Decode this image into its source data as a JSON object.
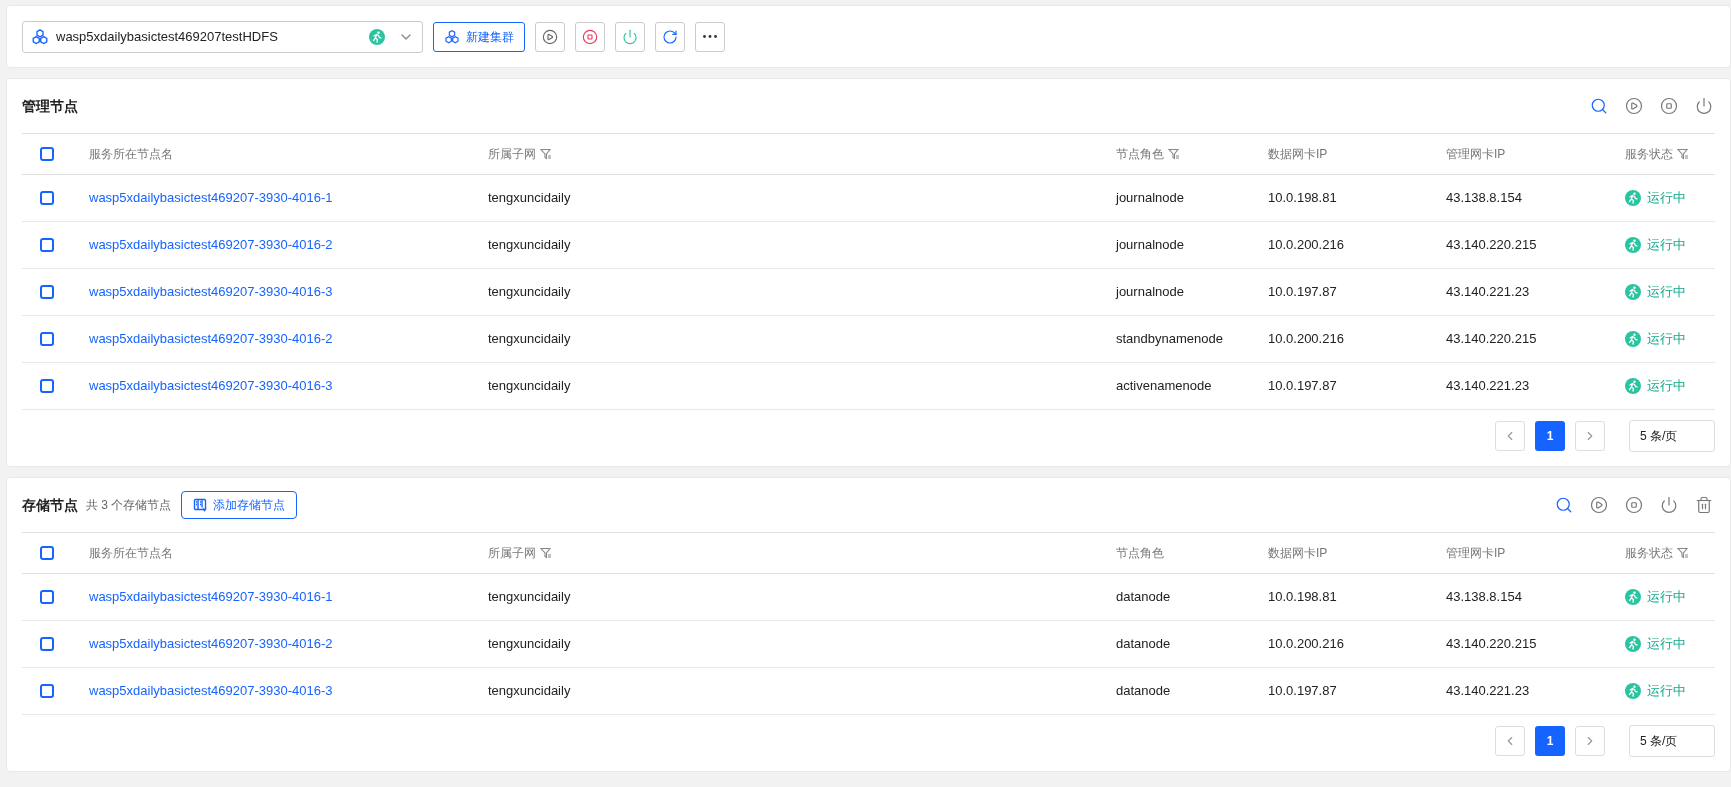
{
  "cluster_select": {
    "value": "wasp5xdailybasictest469207testHDFS",
    "running": true
  },
  "toolbar": {
    "new_cluster": "新建集群",
    "actions": [
      {
        "kind": "start"
      },
      {
        "kind": "stop"
      },
      {
        "kind": "power"
      },
      {
        "kind": "refresh"
      },
      {
        "kind": "more"
      }
    ]
  },
  "sections": [
    {
      "title": "管理节点",
      "actions": [
        {
          "kind": "search"
        },
        {
          "kind": "start"
        },
        {
          "kind": "stop"
        },
        {
          "kind": "power"
        }
      ],
      "header_checked": false,
      "columns": [
        {
          "label": "服务所在节点名",
          "filter": false
        },
        {
          "label": "所属子网",
          "filter": true
        },
        {
          "label": "节点角色",
          "filter": true
        },
        {
          "label": "数据网卡IP",
          "filter": false
        },
        {
          "label": "管理网卡IP",
          "filter": false
        },
        {
          "label": "服务状态",
          "filter": true
        }
      ],
      "rows": [
        {
          "checked": false,
          "name": "wasp5xdailybasictest469207-3930-4016-1",
          "subnet": "tengxuncidaily",
          "role": "journalnode",
          "data_ip": "10.0.198.81",
          "mgmt_ip": "43.138.8.154",
          "status": "运行中",
          "running": true
        },
        {
          "checked": false,
          "name": "wasp5xdailybasictest469207-3930-4016-2",
          "subnet": "tengxuncidaily",
          "role": "journalnode",
          "data_ip": "10.0.200.216",
          "mgmt_ip": "43.140.220.215",
          "status": "运行中",
          "running": true
        },
        {
          "checked": false,
          "name": "wasp5xdailybasictest469207-3930-4016-3",
          "subnet": "tengxuncidaily",
          "role": "journalnode",
          "data_ip": "10.0.197.87",
          "mgmt_ip": "43.140.221.23",
          "status": "运行中",
          "running": true
        },
        {
          "checked": false,
          "name": "wasp5xdailybasictest469207-3930-4016-2",
          "subnet": "tengxuncidaily",
          "role": "standbynamenode",
          "data_ip": "10.0.200.216",
          "mgmt_ip": "43.140.220.215",
          "status": "运行中",
          "running": true
        },
        {
          "checked": false,
          "name": "wasp5xdailybasictest469207-3930-4016-3",
          "subnet": "tengxuncidaily",
          "role": "activenamenode",
          "data_ip": "10.0.197.87",
          "mgmt_ip": "43.140.221.23",
          "status": "运行中",
          "running": true
        }
      ],
      "pagination": {
        "pages": [
          {
            "label": "1",
            "selected": true
          }
        ],
        "page_size": "5 条/页"
      }
    },
    {
      "title": "存储节点",
      "subtitle": "共 3 个存储节点",
      "add_button": "添加存储节点",
      "actions": [
        {
          "kind": "search"
        },
        {
          "kind": "start"
        },
        {
          "kind": "stop"
        },
        {
          "kind": "power"
        },
        {
          "kind": "delete"
        }
      ],
      "header_checked": false,
      "columns": [
        {
          "label": "服务所在节点名",
          "filter": false
        },
        {
          "label": "所属子网",
          "filter": true
        },
        {
          "label": "节点角色",
          "filter": false
        },
        {
          "label": "数据网卡IP",
          "filter": false
        },
        {
          "label": "管理网卡IP",
          "filter": false
        },
        {
          "label": "服务状态",
          "filter": true
        }
      ],
      "rows": [
        {
          "checked": false,
          "name": "wasp5xdailybasictest469207-3930-4016-1",
          "subnet": "tengxuncidaily",
          "role": "datanode",
          "data_ip": "10.0.198.81",
          "mgmt_ip": "43.138.8.154",
          "status": "运行中",
          "running": true
        },
        {
          "checked": false,
          "name": "wasp5xdailybasictest469207-3930-4016-2",
          "subnet": "tengxuncidaily",
          "role": "datanode",
          "data_ip": "10.0.200.216",
          "mgmt_ip": "43.140.220.215",
          "status": "运行中",
          "running": true
        },
        {
          "checked": false,
          "name": "wasp5xdailybasictest469207-3930-4016-3",
          "subnet": "tengxuncidaily",
          "role": "datanode",
          "data_ip": "10.0.197.87",
          "mgmt_ip": "43.140.221.23",
          "status": "运行中",
          "running": true
        }
      ],
      "pagination": {
        "pages": [
          {
            "label": "1",
            "selected": true
          }
        ],
        "page_size": "5 条/页"
      }
    }
  ]
}
